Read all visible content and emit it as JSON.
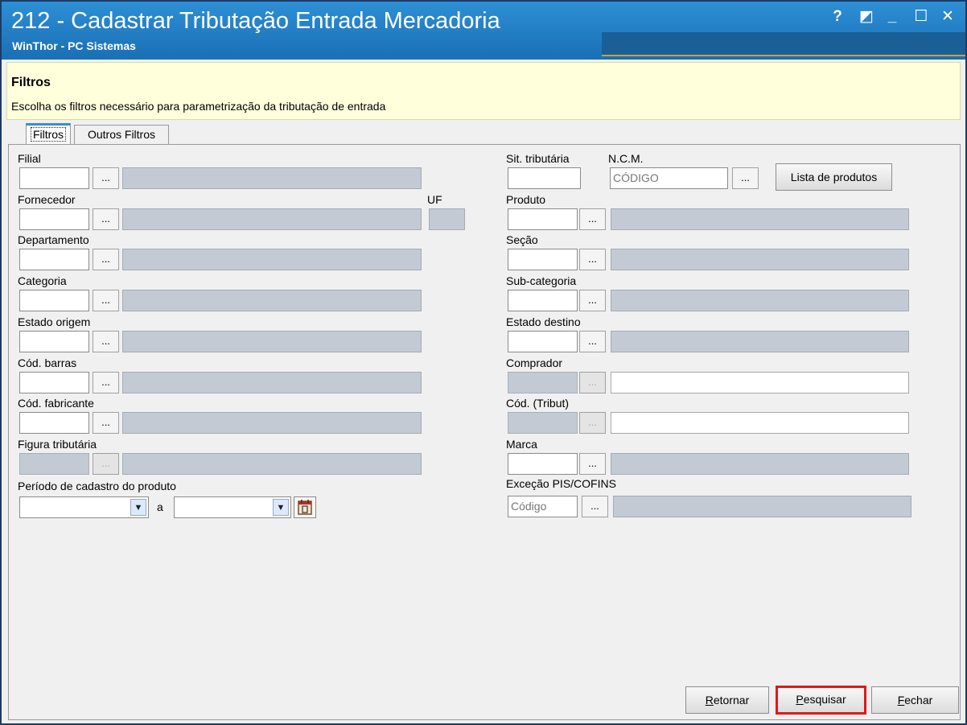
{
  "window": {
    "title": "212 - Cadastrar Tributação Entrada Mercadoria",
    "subtitle": "WinThor - PC Sistemas",
    "controls": {
      "help": "?",
      "restore": "◩",
      "minimize": "_",
      "maximize": "☐",
      "close": "✕"
    }
  },
  "header": {
    "title": "Filtros",
    "description": "Escolha os filtros necessário para parametrização da tributação de entrada"
  },
  "tabs": [
    {
      "label": "Filtros",
      "active": true
    },
    {
      "label": "Outros Filtros",
      "active": false
    }
  ],
  "left_fields": {
    "filial": "Filial",
    "fornecedor": "Fornecedor",
    "uf": "UF",
    "departamento": "Departamento",
    "categoria": "Categoria",
    "estado_origem": "Estado origem",
    "cod_barras": "Cód. barras",
    "cod_fabricante": "Cód. fabricante",
    "figura_tributaria": "Figura tributária",
    "periodo": "Período de cadastro do produto",
    "periodo_sep": "a"
  },
  "right_fields": {
    "sit_tributaria": "Sit. tributária",
    "ncm": "N.C.M.",
    "ncm_placeholder": "CÓDIGO",
    "lista_produtos": "Lista de produtos",
    "produto": "Produto",
    "secao": "Seção",
    "subcategoria": "Sub-categoria",
    "estado_destino": "Estado destino",
    "comprador": "Comprador",
    "cod_tribut": "Cód. (Tribut)",
    "marca": "Marca",
    "excecao": "Exceção PIS/COFINS",
    "excecao_placeholder": "Código"
  },
  "lookup_button": "...",
  "dropdown_arrow": "▼",
  "buttons": {
    "retornar": {
      "first": "R",
      "rest": "etornar"
    },
    "pesquisar": {
      "first": "P",
      "rest": "esquisar"
    },
    "fechar": {
      "first": "F",
      "rest": "echar"
    }
  },
  "colors": {
    "titlebar": "#1a6fb5",
    "header_bg": "#ffffdc",
    "highlight": "#e01818"
  }
}
